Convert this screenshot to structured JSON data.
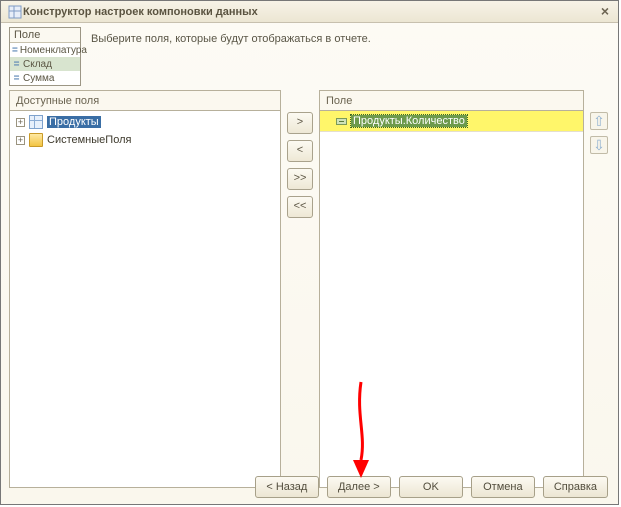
{
  "window": {
    "title": "Конструктор настроек компоновки данных",
    "close_symbol": "×"
  },
  "legend": {
    "header": "Поле",
    "items": [
      {
        "label": "Номенклатура",
        "selected": false
      },
      {
        "label": "Склад",
        "selected": true
      },
      {
        "label": "Сумма",
        "selected": false
      }
    ]
  },
  "instruction": "Выберите поля, которые будут отображаться в отчете.",
  "left_panel": {
    "header": "Доступные поля",
    "tree": [
      {
        "expander": "+",
        "icon": "table",
        "label": "Продукты",
        "selected": true
      },
      {
        "expander": "+",
        "icon": "folder",
        "label": "СистемныеПоля",
        "selected": false
      }
    ]
  },
  "mid_buttons": {
    "add": ">",
    "remove": "<",
    "add_all": ">>",
    "remove_all": "<<"
  },
  "right_panel": {
    "header": "Поле",
    "rows": [
      {
        "label": "Продукты.Количество",
        "highlighted": true
      }
    ]
  },
  "updown": {
    "up": "⇧",
    "down": "⇩"
  },
  "footer": {
    "back": "< Назад",
    "next": "Далее >",
    "ok": "OK",
    "cancel": "Отмена",
    "help": "Справка"
  }
}
